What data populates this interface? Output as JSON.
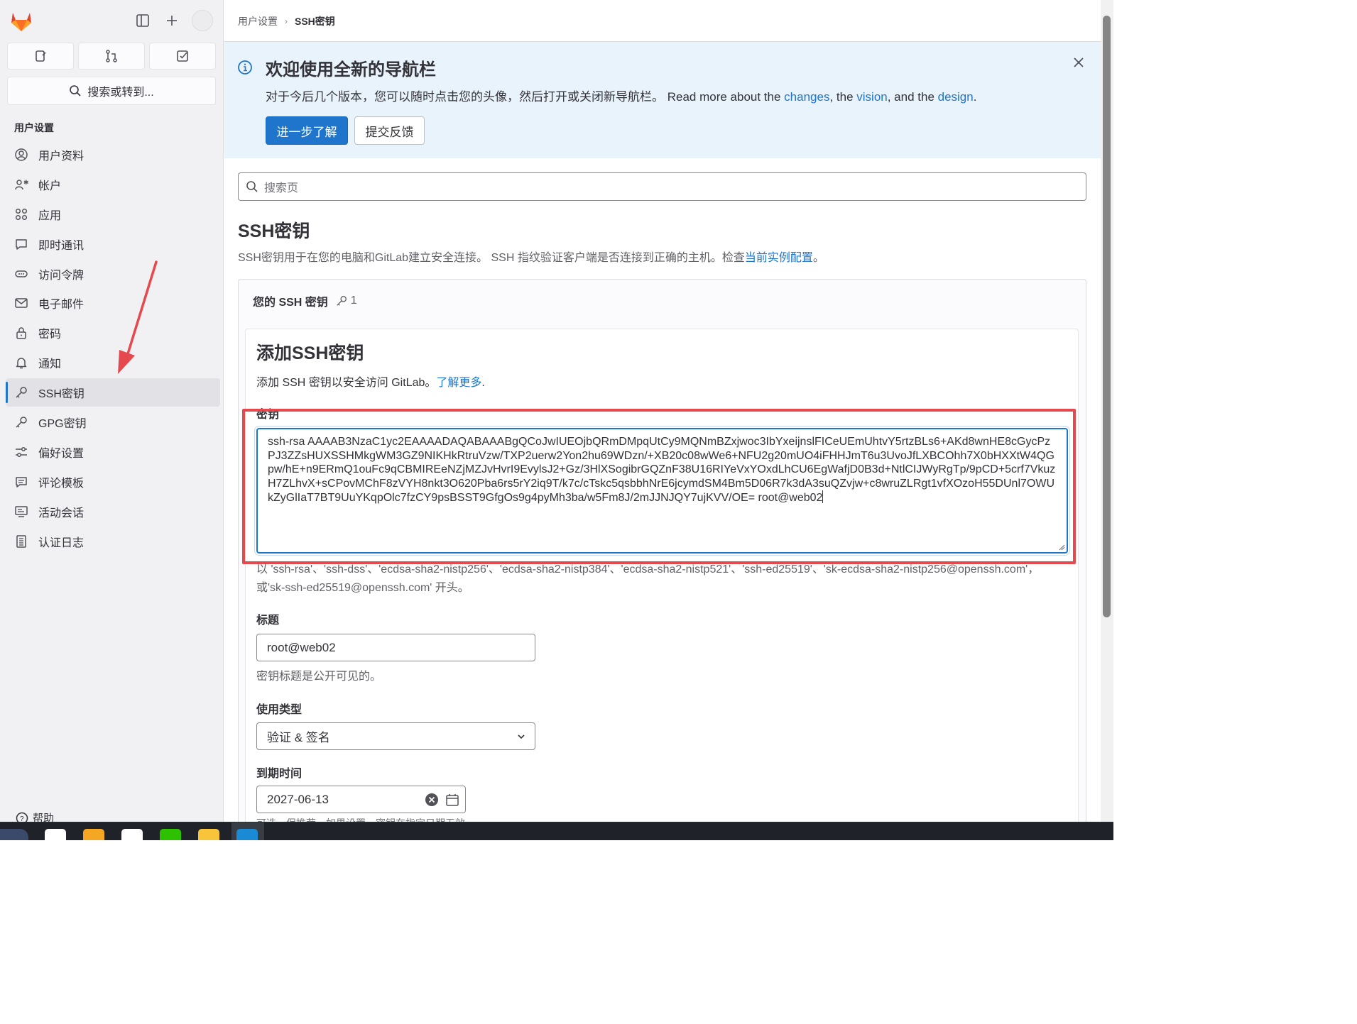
{
  "sidebar": {
    "search_label": "搜索或转到...",
    "section_title": "用户设置",
    "items": [
      {
        "label": "用户资料",
        "icon": "profile-icon"
      },
      {
        "label": "帐户",
        "icon": "account-icon"
      },
      {
        "label": "应用",
        "icon": "applications-icon"
      },
      {
        "label": "即时通讯",
        "icon": "chat-icon"
      },
      {
        "label": "访问令牌",
        "icon": "token-icon"
      },
      {
        "label": "电子邮件",
        "icon": "mail-icon"
      },
      {
        "label": "密码",
        "icon": "lock-icon"
      },
      {
        "label": "通知",
        "icon": "bell-icon"
      },
      {
        "label": "SSH密钥",
        "icon": "key-icon",
        "active": true
      },
      {
        "label": "GPG密钥",
        "icon": "key-icon"
      },
      {
        "label": "偏好设置",
        "icon": "preferences-icon"
      },
      {
        "label": "评论模板",
        "icon": "comment-template-icon"
      },
      {
        "label": "活动会话",
        "icon": "monitor-icon"
      },
      {
        "label": "认证日志",
        "icon": "log-icon"
      }
    ],
    "help_label": "帮助"
  },
  "breadcrumb": {
    "parent": "用户设置",
    "current": "SSH密钥"
  },
  "banner": {
    "title": "欢迎使用全新的导航栏",
    "text_prefix": "对于今后几个版本，您可以随时点击您的头像，然后打开或关闭新导航栏。 Read more about the ",
    "link_changes": "changes",
    "sep1": ", the ",
    "link_vision": "vision",
    "sep2": ", and the ",
    "link_design": "design",
    "suffix": ".",
    "primary_button": "进一步了解",
    "secondary_button": "提交反馈"
  },
  "page_search": {
    "placeholder": "搜索页"
  },
  "page": {
    "title": "SSH密钥",
    "desc_prefix": "SSH密钥用于在您的电脑和GitLab建立安全连接。 SSH 指纹验证客户端是否连接到正确的主机。检查",
    "desc_link": "当前实例配置",
    "desc_suffix": "。"
  },
  "keys_card": {
    "title": "您的 SSH 密钥",
    "count": "1"
  },
  "add_form": {
    "title": "添加SSH密钥",
    "desc": "添加 SSH 密钥以安全访问 GitLab。",
    "desc_link": "了解更多",
    "desc_suffix": ".",
    "key_label": "密钥",
    "key_value": "ssh-rsa AAAAB3NzaC1yc2EAAAADAQABAAABgQCoJwIUEOjbQRmDMpqUtCy9MQNmBZxjwoc3IbYxeijnslFICeUEmUhtvY5rtzBLs6+AKd8wnHE8cGycPzPJ3ZZsHUXSSHMkgWM3GZ9NIKHkRtruVzw/TXP2uerw2Yon2hu69WDzn/+XB20c08wWe6+NFU2g20mUO4iFHHJmT6u3UvoJfLXBCOhh7X0bHXXtW4QGpw/hE+n9ERmQ1ouFc9qCBMIREeNZjMZJvHvrI9EvylsJ2+Gz/3HlXSogibrGQZnF38U16RIYeVxYOxdLhCU6EgWafjD0B3d+NtlCIJWyRgTp/9pCD+5crf7VkuzH7ZLhvX+sCPovMChF8zVYH8nkt3O620Pba6rs5rY2iq9T/k7c/cTskc5qsbbhNrE6jcymdSM4Bm5D06R7k3dA3suQZvjw+c8wruZLRgt1vfXOzoH55DUnl7OWUkZyGlIaT7BT9UuYKqpOlc7fzCY9psBSST9GfgOs9g4pyMh3ba/w5Fm8J/2mJJNJQY7ujKVV/OE= root@web02",
    "key_help": "以 'ssh-rsa'、'ssh-dss'、'ecdsa-sha2-nistp256'、'ecdsa-sha2-nistp384'、'ecdsa-sha2-nistp521'、'ssh-ed25519'、'sk-ecdsa-sha2-nistp256@openssh.com'，或'sk-ssh-ed25519@openssh.com' 开头。",
    "title_label": "标题",
    "title_value": "root@web02",
    "title_help": "密钥标题是公开可见的。",
    "usage_label": "使用类型",
    "usage_value": "验证 & 签名",
    "expires_label": "到期时间",
    "expires_value": "2027-06-13",
    "expires_help": "可选。保推荐。如果设置，密钥在指定日期无效。"
  },
  "colors": {
    "accent": "#1f75cb",
    "banner_bg": "#e9f3fc",
    "highlight": "#e5484d"
  }
}
